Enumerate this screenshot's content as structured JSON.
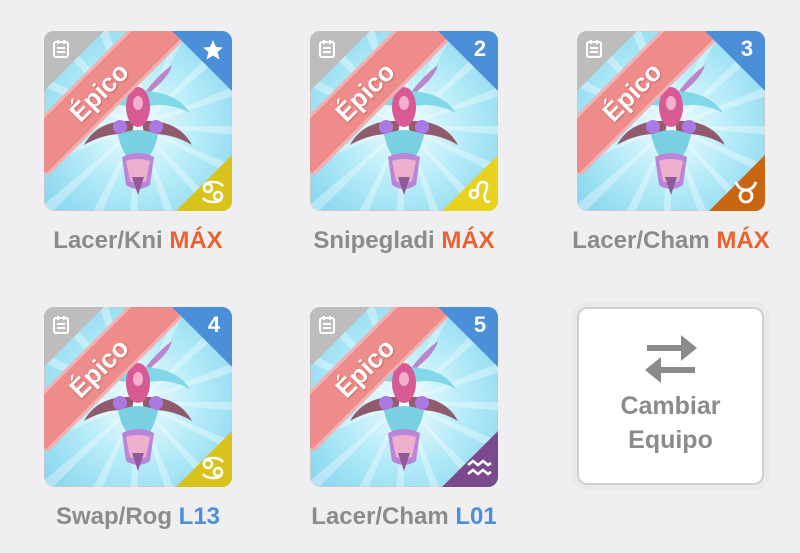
{
  "rarity_label": "Épico",
  "colors": {
    "badge_blue": "#4a8fd8",
    "ribbon_red": "#ee8c8c",
    "level_max_orange": "#e8632e",
    "level_blue": "#4a8fd8",
    "sign_yellow": "#d9c21a",
    "sign_orange": "#c96612",
    "sign_purple": "#7a4a8c"
  },
  "monsters": [
    {
      "name": "Lacer/Kni",
      "level": "MÁX",
      "badge": "star-icon",
      "sign": "cancer-icon",
      "sign_color": "#d9c21a"
    },
    {
      "name": "Snipegladi",
      "level": "MÁX",
      "badge": "2",
      "sign": "leo-icon",
      "sign_color": "#e8d21f"
    },
    {
      "name": "Lacer/Cham",
      "level": "MÁX",
      "badge": "3",
      "sign": "taurus-icon",
      "sign_color": "#c96612"
    },
    {
      "name": "Swap/Rog",
      "level": "L13",
      "badge": "4",
      "sign": "cancer-icon",
      "sign_color": "#d9c21a"
    },
    {
      "name": "Lacer/Cham",
      "level": "L01",
      "badge": "5",
      "sign": "aquarius-icon",
      "sign_color": "#7a4a8c"
    }
  ],
  "swap_button": {
    "line1": "Cambiar",
    "line2": "Equipo"
  }
}
